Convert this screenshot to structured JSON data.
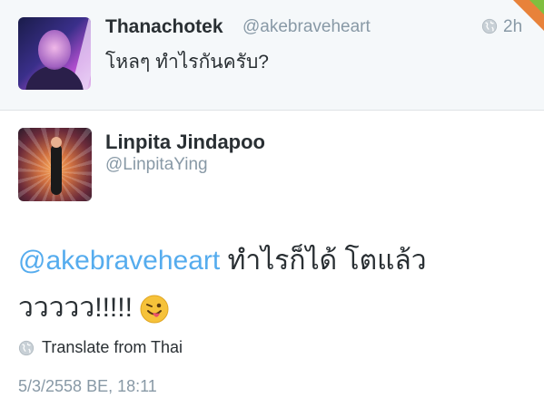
{
  "parent_tweet": {
    "display_name": "Thanachotek",
    "handle": "@akebraveheart",
    "time": "2h",
    "text": "โหลๆ ทำไรกันครับ?"
  },
  "tweet": {
    "display_name": "Linpita Jindapoo",
    "handle": "@LinpitaYing",
    "mention": "@akebraveheart",
    "text_line1_rest": " ทำไรก็ได้ โตแล้ว",
    "text_line2": "ววววว!!!!!",
    "emoji": "winking-face-with-tongue",
    "translate_label": "Translate from Thai",
    "timestamp": "5/3/2558 BE, 18:11"
  },
  "colors": {
    "link": "#55acee",
    "secondary_text": "#8899a6",
    "primary_text": "#292f33",
    "parent_background": "#f5f8fa"
  },
  "icons": [
    "globe-icon",
    "winking-face-with-tongue-emoji"
  ]
}
